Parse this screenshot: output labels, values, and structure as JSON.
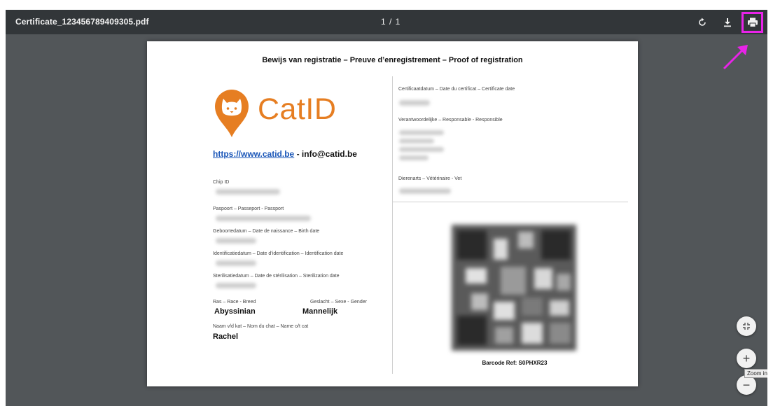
{
  "toolbar": {
    "file_name": "Certificate_123456789409305.pdf",
    "page_indicator": "1 / 1",
    "icons": [
      "rotate-icon",
      "download-icon",
      "print-icon"
    ]
  },
  "document": {
    "title": "Bewijs van registratie – Preuve d’enregistrement – Proof of registration",
    "brand": "CatID",
    "brand_color": "#e67e22",
    "website": "https://www.catid.be",
    "website_separator": " - ",
    "email": "info@catid.be",
    "left_fields": {
      "chip_id_label": "Chip ID",
      "passport_label": "Paspoort – Passeport - Passport",
      "birth_label": "Geboortedatum – Date de naissance – Birth date",
      "identification_label": "Identificatiedatum – Date d’identification – Identification date",
      "sterilization_label": "Sterilisatiedatum – Date de stérilisation – Sterilization date",
      "breed_label": "Ras – Race - Breed",
      "breed_value": "Abyssinian",
      "gender_label": "Geslacht – Sexe - Gender",
      "gender_value": "Mannelijk",
      "name_label": "Naam v/d kat – Nom du chat – Name o/t cat",
      "name_value": "Rachel"
    },
    "right_fields": {
      "certificate_date_label": "Certificaatdatum – Date du certificat – Certificate date",
      "responsible_label": "Verantwoordelijke – Responsable - Responsible",
      "vet_label": "Dierenarts – Vétérinaire - Vet"
    },
    "barcode_ref": "Barcode Ref: S0PHXR23"
  },
  "zoom_controls": {
    "zoom_in_tooltip": "Zoom in",
    "zoom_in_symbol": "+",
    "zoom_out_symbol": "−"
  },
  "annotation": {
    "highlight_color": "#e823e8"
  }
}
